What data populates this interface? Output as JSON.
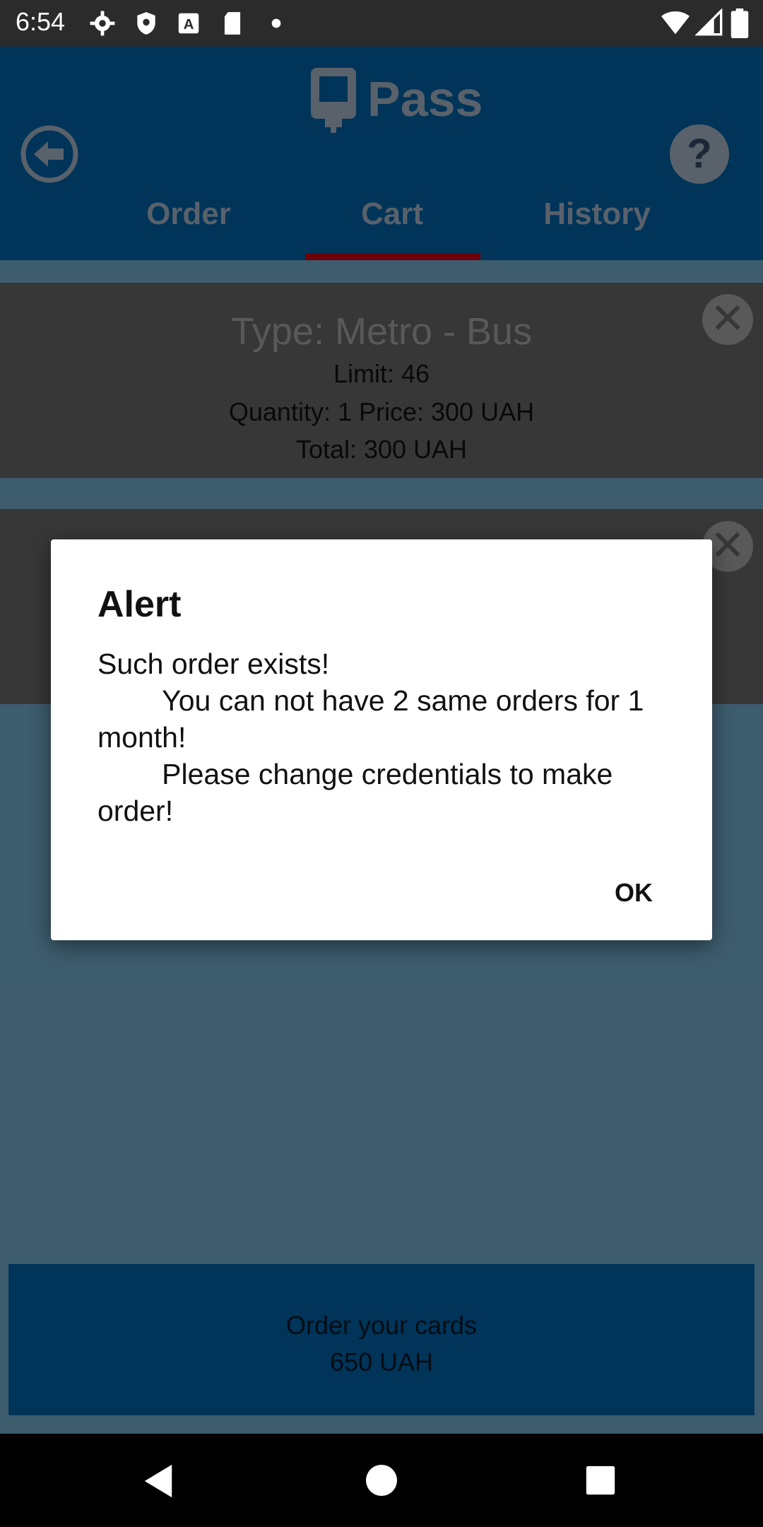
{
  "status_bar": {
    "time": "6:54",
    "icons_left": [
      "settings-icon",
      "shield-icon",
      "a-box-icon",
      "sd-card-icon",
      "dot-icon"
    ],
    "icons_right": [
      "wifi-icon",
      "cell-signal-icon",
      "battery-icon"
    ]
  },
  "app": {
    "title": "Pass",
    "logo_icon": "tram-icon",
    "back_icon": "back-arrow-circle-icon",
    "help_label": "?",
    "tabs": [
      {
        "label": "Order",
        "active": false
      },
      {
        "label": "Cart",
        "active": true
      },
      {
        "label": "History",
        "active": false
      }
    ]
  },
  "cart": {
    "items": [
      {
        "type": "Type: Metro - Bus",
        "limit": "Limit:  46",
        "quantity_price": "Quantity:  1 Price:  300 UAH",
        "total": "Total: 300 UAH",
        "remove_label": "✕"
      },
      {
        "remove_label": "✕"
      }
    ],
    "order_button": {
      "line1": "Order your cards",
      "line2": "650 UAH"
    }
  },
  "dialog": {
    "title": "Alert",
    "message": "Such order exists!\n        You can not have 2 same orders for 1 month!\n        Please change credentials to make order!",
    "ok_label": "OK"
  },
  "colors": {
    "header": "#005a9a",
    "tab_indicator": "#c00010",
    "card": "#5f5f5f"
  }
}
